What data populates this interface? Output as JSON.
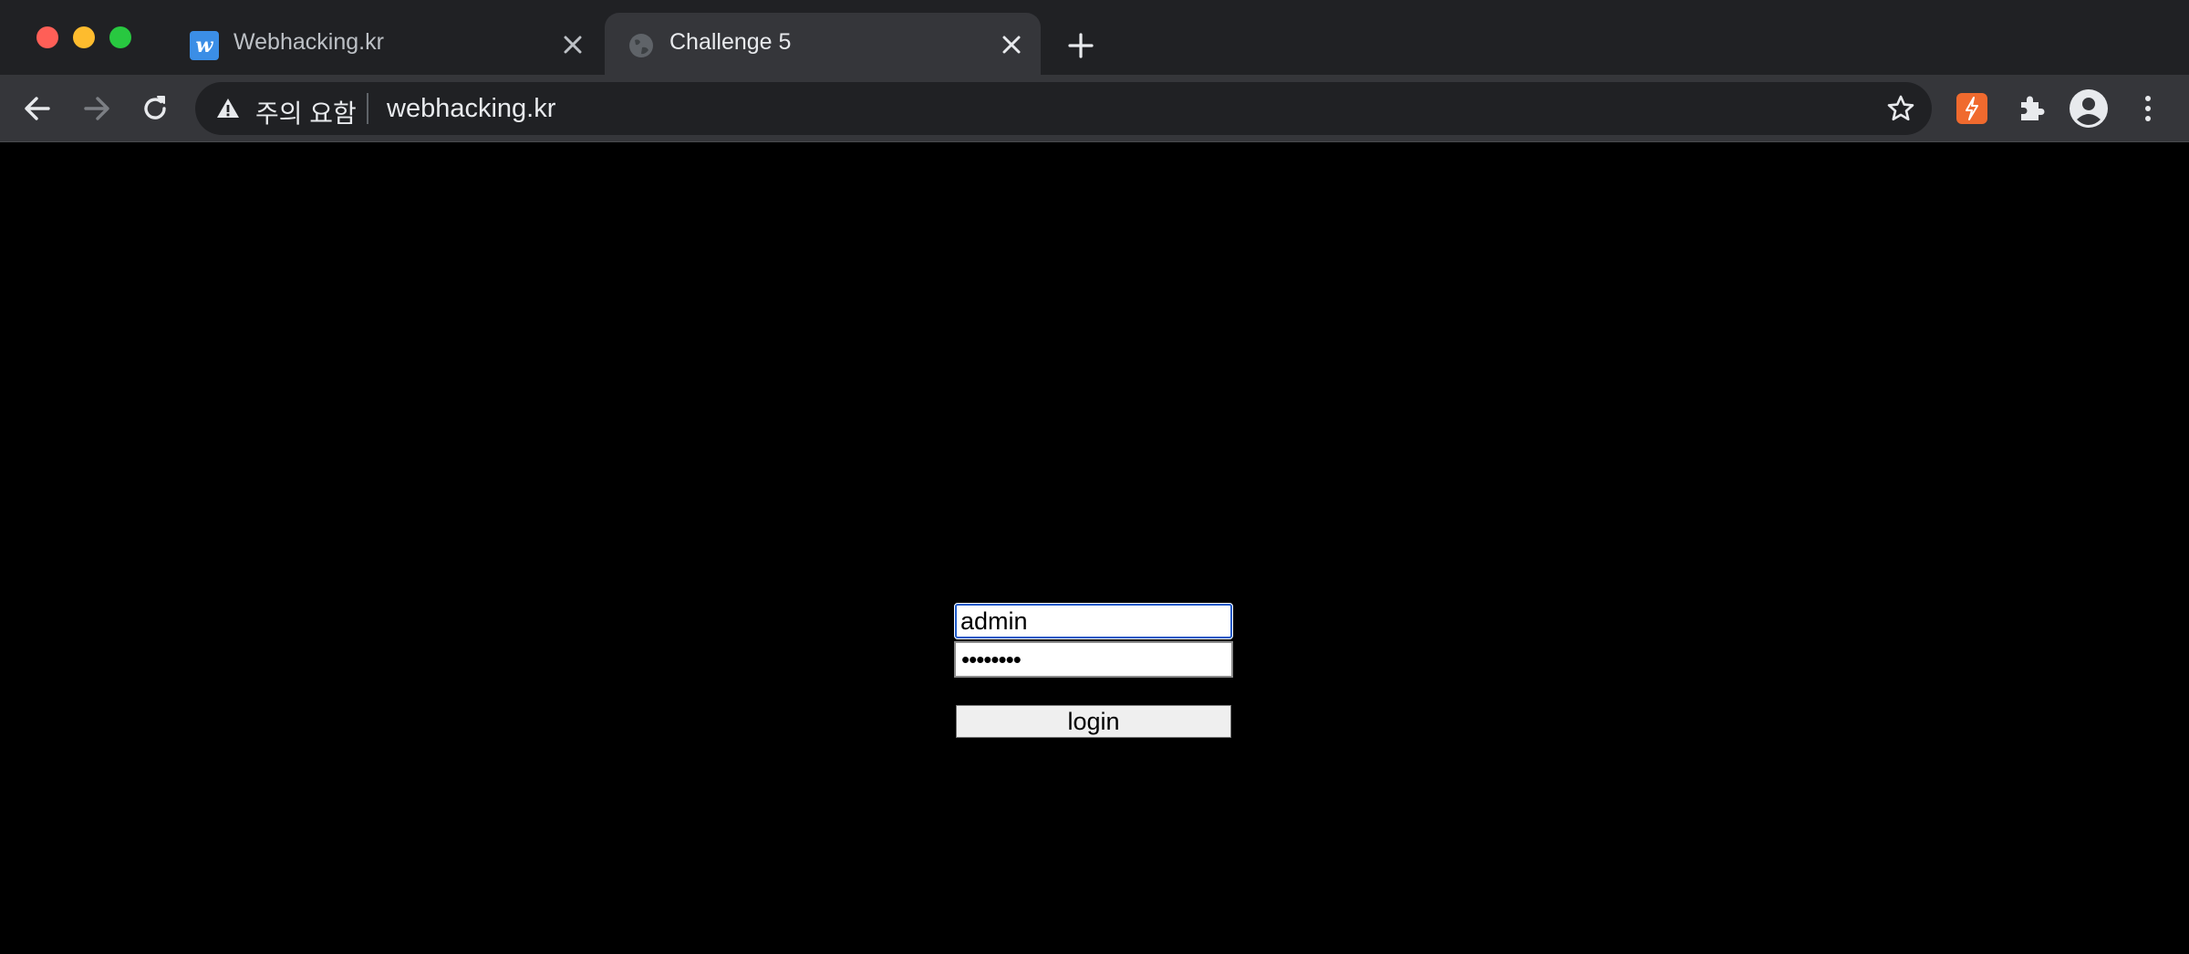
{
  "browser": {
    "tabs": [
      {
        "title": "Webhacking.kr",
        "favicon_letter": "w",
        "active": false
      },
      {
        "title": "Challenge 5",
        "active": true
      }
    ],
    "address_bar": {
      "security_status": "주의 요함",
      "url": "webhacking.kr"
    }
  },
  "page": {
    "background_color": "#000000",
    "form": {
      "id_value": "admin",
      "password_masked": "••••••••",
      "login_label": "login"
    }
  },
  "colors": {
    "focus_ring": "#1f5ac8",
    "extension_accent": "#f06a2e",
    "favicon_accent": "#3b8ee6"
  }
}
